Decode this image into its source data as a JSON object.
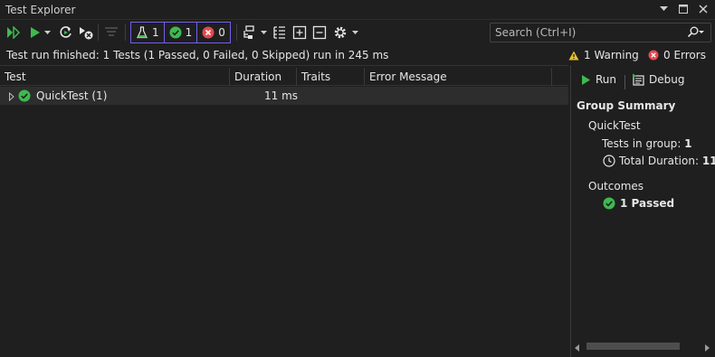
{
  "window": {
    "title": "Test Explorer"
  },
  "toolbar": {
    "filters": [
      {
        "icon": "flask-icon",
        "count": "1"
      },
      {
        "icon": "passed-icon",
        "count": "1"
      },
      {
        "icon": "failed-icon",
        "count": "0"
      }
    ],
    "search_placeholder": "Search (Ctrl+I)"
  },
  "status": {
    "message": "Test run finished: 1 Tests (1 Passed, 0 Failed, 0 Skipped) run in 245 ms",
    "warnings": "1 Warning",
    "errors": "0 Errors"
  },
  "grid": {
    "columns": [
      "Test",
      "Duration",
      "Traits",
      "Error Message"
    ],
    "rows": [
      {
        "name": "QuickTest  (1)",
        "duration": "11 ms",
        "traits": "",
        "error": "",
        "outcome": "passed"
      }
    ]
  },
  "summary": {
    "run_label": "Run",
    "debug_label": "Debug",
    "heading": "Group Summary",
    "group_name": "QuickTest",
    "tests_in_group_label": "Tests in group",
    "tests_in_group_value": "1",
    "total_duration_label": "Total Duration",
    "total_duration_value": "11",
    "outcomes_label": "Outcomes",
    "passed_label": "1 Passed"
  },
  "colors": {
    "accent": "#7160e8",
    "pass": "#3fb950",
    "fail": "#e5484d",
    "warn": "#e6c229"
  }
}
